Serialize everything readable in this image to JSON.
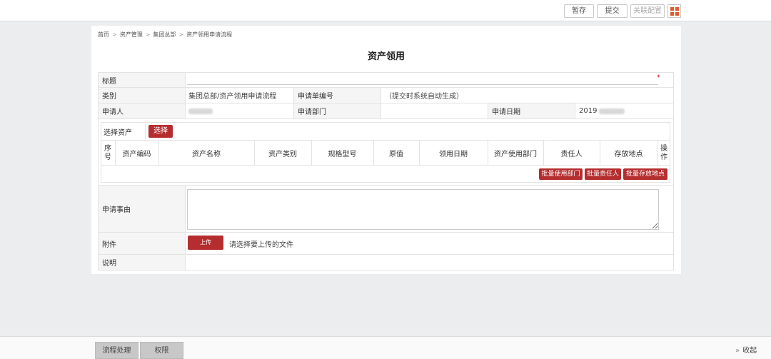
{
  "toolbar": {
    "save_draft": "暂存",
    "submit": "提交",
    "related_config": "关联配置"
  },
  "breadcrumb": [
    "首页",
    "资产管理",
    "集团总部",
    "资产领用申请流程"
  ],
  "form": {
    "title": "资产领用",
    "fields": {
      "subject_label": "标题",
      "required_mark": "*",
      "category_label": "类别",
      "category_value": "集团总部/资产领用申请流程",
      "form_no_label": "申请单编号",
      "form_no_value": "（提交时系统自动生成）",
      "applicant_label": "申请人",
      "dept_label": "申请部门",
      "date_label": "申请日期",
      "date_value": "2019"
    },
    "assets": {
      "select_label": "选择资产",
      "select_button": "选择",
      "columns": [
        "序号",
        "资产编码",
        "资产名称",
        "资产类别",
        "规格型号",
        "原值",
        "领用日期",
        "资产使用部门",
        "责任人",
        "存放地点",
        "操作"
      ],
      "batch_buttons": [
        "批量使用部门",
        "批量责任人",
        "批量存放地点"
      ]
    },
    "reason_label": "申请事由",
    "attachment_label": "附件",
    "upload_button": "上传",
    "upload_hint": "请选择要上传的文件",
    "note_label": "说明"
  },
  "bottom": {
    "tabs": [
      "流程处理",
      "权限"
    ],
    "collapse": "收起"
  },
  "colors": {
    "accent": "#b52d2e",
    "grid_icon": "#e05a2a"
  }
}
